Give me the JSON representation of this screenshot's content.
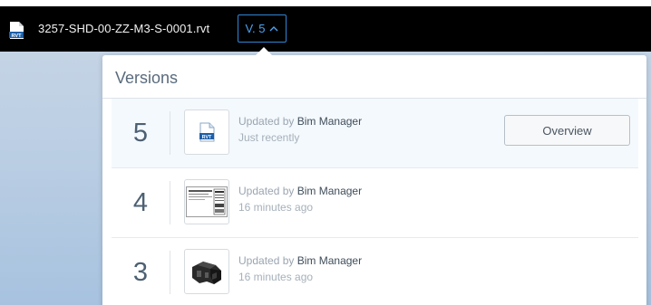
{
  "header": {
    "file_name": "3257-SHD-00-ZZ-M3-S-0001.rvt",
    "file_icon_label": "RVT",
    "version_label": "V. 5",
    "accent_color": "#2f86d6"
  },
  "versions_panel": {
    "title": "Versions",
    "updated_by_label": "Updated by",
    "overview_label": "Overview",
    "items": [
      {
        "number": "5",
        "user": "Bim Manager",
        "time": "Just recently",
        "thumbnail": "rvt-file-icon",
        "icon_label": "RVT",
        "selected": true
      },
      {
        "number": "4",
        "user": "Bim Manager",
        "time": "16 minutes ago",
        "thumbnail": "drawing-sheet-thumbnail",
        "selected": false
      },
      {
        "number": "3",
        "user": "Bim Manager",
        "time": "16 minutes ago",
        "thumbnail": "3d-model-thumbnail",
        "selected": false
      }
    ]
  }
}
